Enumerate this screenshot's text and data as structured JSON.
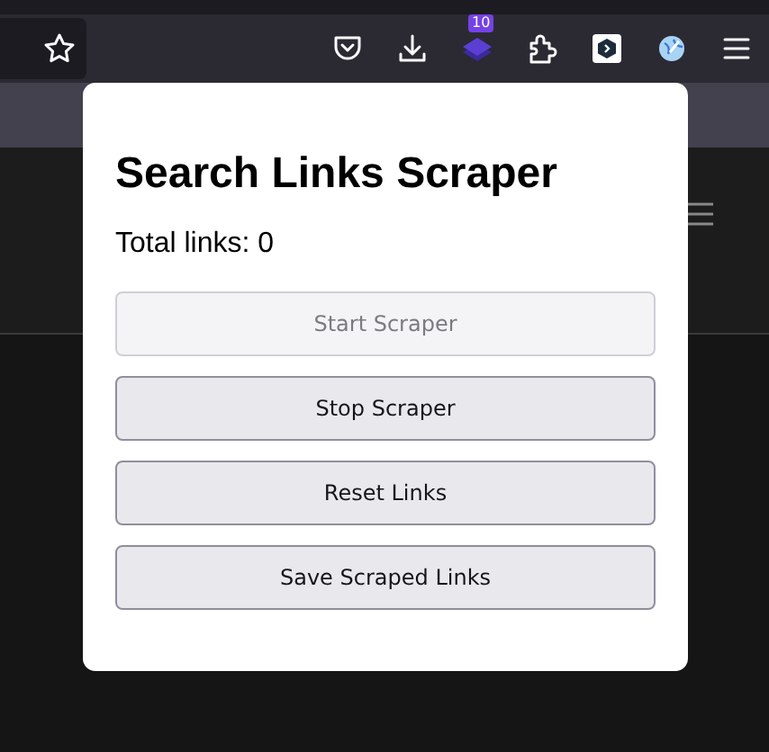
{
  "toolbar": {
    "extension_badge": "10"
  },
  "popup": {
    "title": "Search Links Scraper",
    "total_links": "Total links: 0",
    "buttons": [
      {
        "label": "Start Scraper",
        "disabled": true
      },
      {
        "label": "Stop Scraper",
        "disabled": false
      },
      {
        "label": "Reset Links",
        "disabled": false
      },
      {
        "label": "Save Scraped Links",
        "disabled": false
      }
    ]
  }
}
